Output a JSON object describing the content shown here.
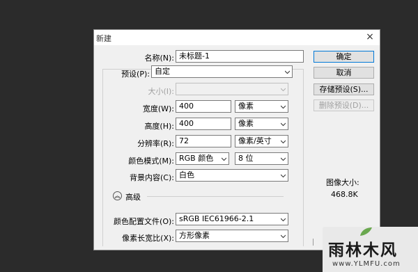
{
  "dialog": {
    "title": "新建",
    "close_glyph": "×"
  },
  "form": {
    "name_label": "名称(N):",
    "name_value": "未标题-1",
    "preset_label": "预设(P):",
    "preset_value": "自定",
    "size_label": "大小(I):",
    "size_value": "",
    "width_label": "宽度(W):",
    "width_value": "400",
    "width_unit": "像素",
    "height_label": "高度(H):",
    "height_value": "400",
    "height_unit": "像素",
    "resolution_label": "分辨率(R):",
    "resolution_value": "72",
    "resolution_unit": "像素/英寸",
    "color_mode_label": "颜色模式(M):",
    "color_mode_value": "RGB 颜色",
    "bit_depth_value": "8 位",
    "background_label": "背景内容(C):",
    "background_value": "白色",
    "advanced_label": "高级",
    "advanced_glyph": "︽",
    "color_profile_label": "颜色配置文件(O):",
    "color_profile_value": "sRGB IEC61966-2.1",
    "pixel_aspect_label": "像素长宽比(X):",
    "pixel_aspect_value": "方形像素"
  },
  "buttons": {
    "ok": "确定",
    "cancel": "取消",
    "save_preset": "存储预设(S)...",
    "delete_preset": "删除预设(D)..."
  },
  "image_size": {
    "label": "图像大小:",
    "value": "468.8K"
  },
  "watermark": {
    "text": "雨林木风",
    "url": "www.YLMFU.com"
  },
  "colors": {
    "backdrop": "#2b2b2b",
    "dialog_bg": "#f0f0f0",
    "primary_border": "#0078d7"
  }
}
